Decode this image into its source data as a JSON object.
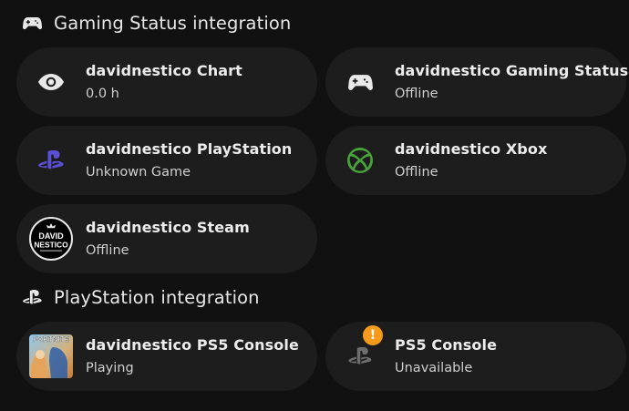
{
  "sections": [
    {
      "title": "Gaming Status integration",
      "icon": "gamepad-icon",
      "cards": [
        {
          "name": "davidnestico Chart",
          "state": "0.0 h",
          "icon": "eye-icon"
        },
        {
          "name": "davidnestico Gaming Status",
          "state": "Offline",
          "icon": "gamepad-icon"
        },
        {
          "name": "davidnestico PlayStation",
          "state": "Unknown Game",
          "icon": "playstation-logo-icon"
        },
        {
          "name": "davidnestico Xbox",
          "state": "Offline",
          "icon": "xbox-logo-icon"
        },
        {
          "name": "davidnestico Steam",
          "state": "Offline",
          "icon": "david-nestico-avatar",
          "avatar_text": "DAVID NESTICO"
        }
      ]
    },
    {
      "title": "PlayStation integration",
      "icon": "playstation-logo-icon",
      "cards": [
        {
          "name": "davidnestico PS5 Console",
          "state": "Playing",
          "icon": "fortnite-cover-image",
          "cover_text": "FORTNITE"
        },
        {
          "name": "PS5 Console",
          "state": "Unavailable",
          "icon": "playstation-logo-icon",
          "badge": "!"
        }
      ]
    }
  ],
  "colors": {
    "background": "#111111",
    "card": "#1d1d1d",
    "playstation_blue": "#5b4fd6",
    "xbox_green": "#49a33b",
    "warning_orange": "#f59a1b"
  }
}
